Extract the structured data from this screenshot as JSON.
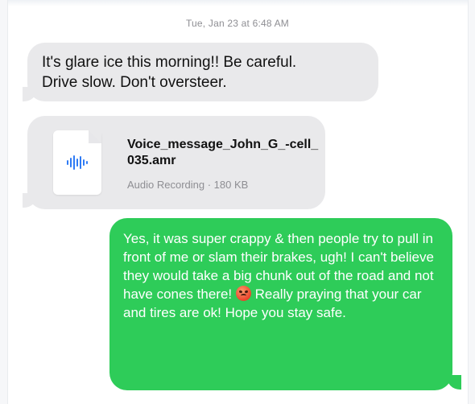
{
  "conversation": {
    "timestamp": "Tue, Jan 23 at 6:48 AM",
    "messages": [
      {
        "direction": "received",
        "type": "text",
        "text": "It's glare ice this morning!! Be careful.\nDrive slow. Don't oversteer."
      },
      {
        "direction": "received",
        "type": "attachment",
        "icon": "audio-waveform-icon",
        "file_name": "Voice_message_John_G_-cell_035.amr",
        "file_meta": "Audio Recording · 180 KB"
      },
      {
        "direction": "sent",
        "type": "text",
        "text_before_emoji": "Yes, it was super crappy & then people try to pull in front of me or slam their brakes, ugh! I can't believe they would take a big chunk out of the road and not have cones there! ",
        "emoji": "angry-face-emoji",
        "text_after_emoji": " Really praying that your car and tires are ok! Hope you stay safe."
      }
    ]
  },
  "colors": {
    "received_bubble": "#e9e9eb",
    "sent_bubble": "#2ecc59",
    "waveform_blue": "#2f7bf5",
    "meta_gray": "#8e8e93"
  }
}
